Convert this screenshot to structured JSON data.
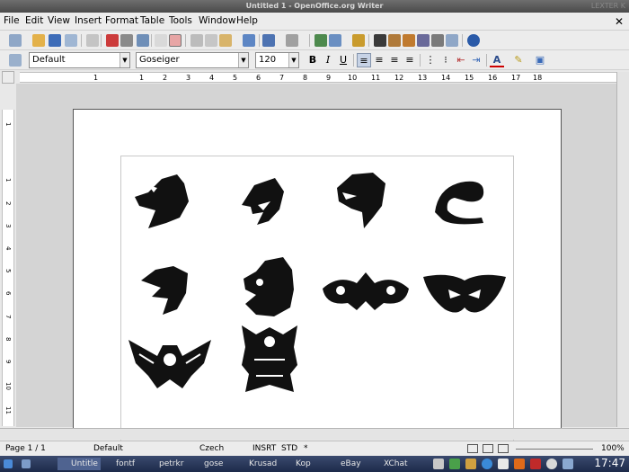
{
  "window": {
    "title": "Untitled 1 - OpenOffice.org Writer",
    "extra": "LEXTER K"
  },
  "menu": [
    "File",
    "Edit",
    "View",
    "Insert",
    "Format",
    "Table",
    "Tools",
    "Window",
    "Help"
  ],
  "formatting": {
    "style": "Default",
    "font": "Goseiger",
    "size": "120",
    "bold": "B",
    "italic": "I",
    "underline": "U"
  },
  "ruler": {
    "horizontal_ticks": [
      "1",
      "1",
      "2",
      "3",
      "4",
      "5",
      "6",
      "7",
      "8",
      "9",
      "10",
      "11",
      "12",
      "13",
      "14",
      "15",
      "16",
      "17",
      "18"
    ],
    "vertical_ticks": [
      "1",
      "1",
      "2",
      "3",
      "4",
      "5",
      "6",
      "7",
      "8",
      "9",
      "10",
      "11"
    ]
  },
  "glyphs": [
    {
      "name": "dragon-head-1"
    },
    {
      "name": "shark-head"
    },
    {
      "name": "dragon-head-2"
    },
    {
      "name": "serpent"
    },
    {
      "name": "eagle-head"
    },
    {
      "name": "lion-head"
    },
    {
      "name": "ornament-1"
    },
    {
      "name": "ornament-2"
    },
    {
      "name": "winged-emblem"
    },
    {
      "name": "totem-emblem"
    }
  ],
  "status": {
    "page": "Page 1 / 1",
    "style": "Default",
    "language": "Czech",
    "insert": "INSRT",
    "selection": "STD",
    "modified": "*",
    "zoom": "100%"
  },
  "taskbar": {
    "tasks": [
      "Untitle",
      "fontf",
      "petrkr",
      "gose",
      "Krusad",
      "Kop",
      "eBay",
      "XChat"
    ],
    "clock": "17:47"
  },
  "colors": {
    "title_bg": "#4a4a4a",
    "taskbar_bg": "#1d2a4a",
    "glyph": "#111111"
  }
}
